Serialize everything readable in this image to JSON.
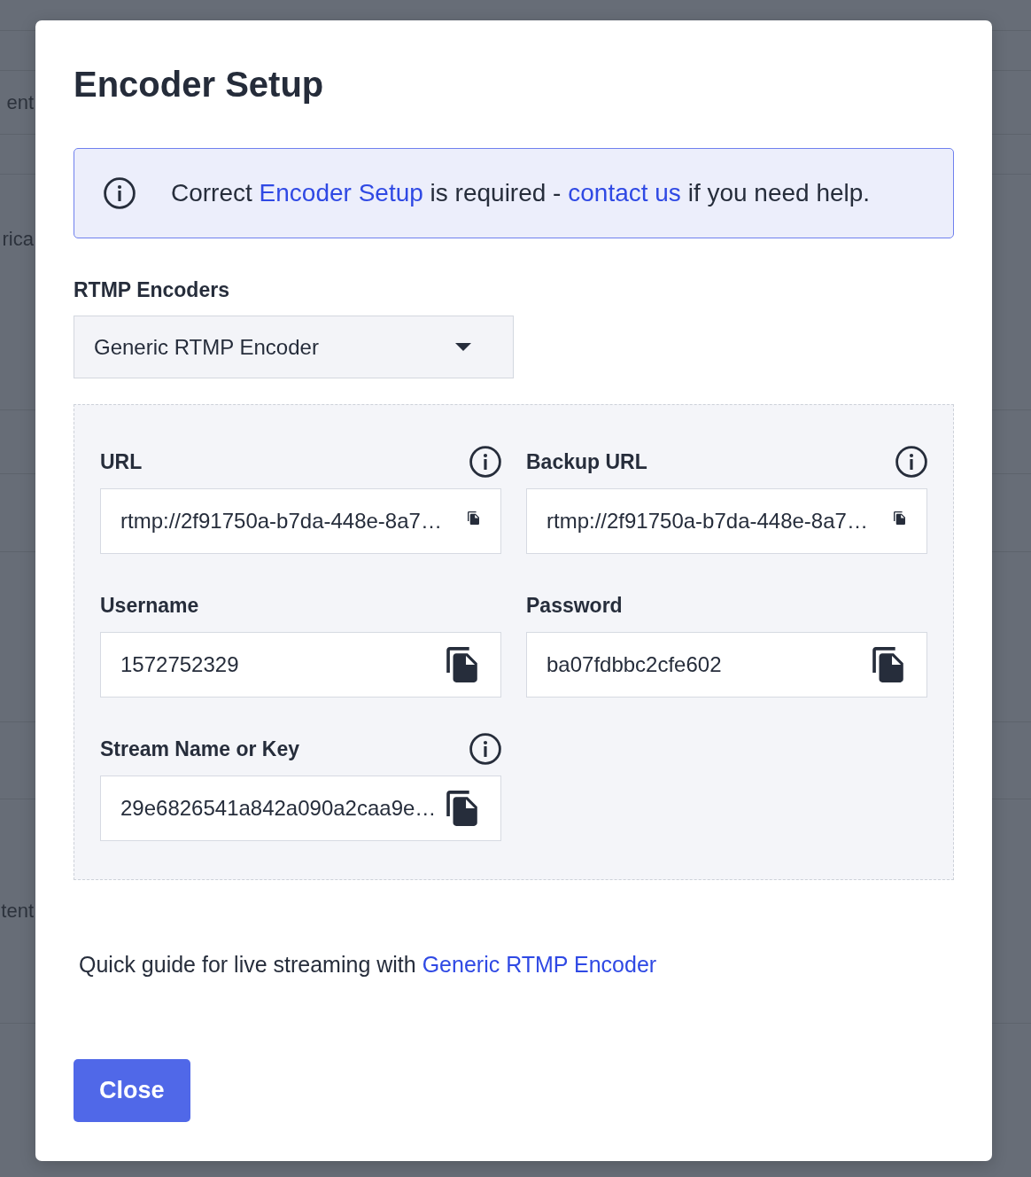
{
  "backdrop": {
    "texts": [
      "ent",
      "rica",
      "tent"
    ]
  },
  "dialog": {
    "title": "Encoder Setup"
  },
  "alert": {
    "parts": [
      {
        "kind": "text",
        "text": "Correct "
      },
      {
        "kind": "link",
        "text": "Encoder Setup"
      },
      {
        "kind": "text",
        "text": " is required - "
      },
      {
        "kind": "link",
        "text": "contact us"
      },
      {
        "kind": "text",
        "text": " if you need help."
      }
    ]
  },
  "encoder_select": {
    "label": "RTMP Encoders",
    "value": "Generic RTMP Encoder"
  },
  "fields": [
    {
      "label": "URL",
      "value": "rtmp://2f91750a-b7da-448e-8a7…",
      "info": true,
      "kind": "url"
    },
    {
      "label": "Backup URL",
      "value": "rtmp://2f91750a-b7da-448e-8a7…",
      "info": true,
      "kind": "url"
    },
    {
      "label": "Username",
      "value": "1572752329",
      "info": false,
      "kind": "plain"
    },
    {
      "label": "Password",
      "value": "ba07fdbbc2cfe602",
      "info": false,
      "kind": "plain"
    },
    {
      "label": "Stream Name or Key",
      "value": "29e6826541a842a090a2caa9e…",
      "info": true,
      "kind": "plain"
    }
  ],
  "guide": {
    "parts": [
      {
        "kind": "text",
        "text": "Quick guide for live streaming with "
      },
      {
        "kind": "link",
        "text": "Generic RTMP Encoder"
      }
    ]
  },
  "buttons": [
    {
      "label": "Close",
      "kind": "primary"
    }
  ]
}
